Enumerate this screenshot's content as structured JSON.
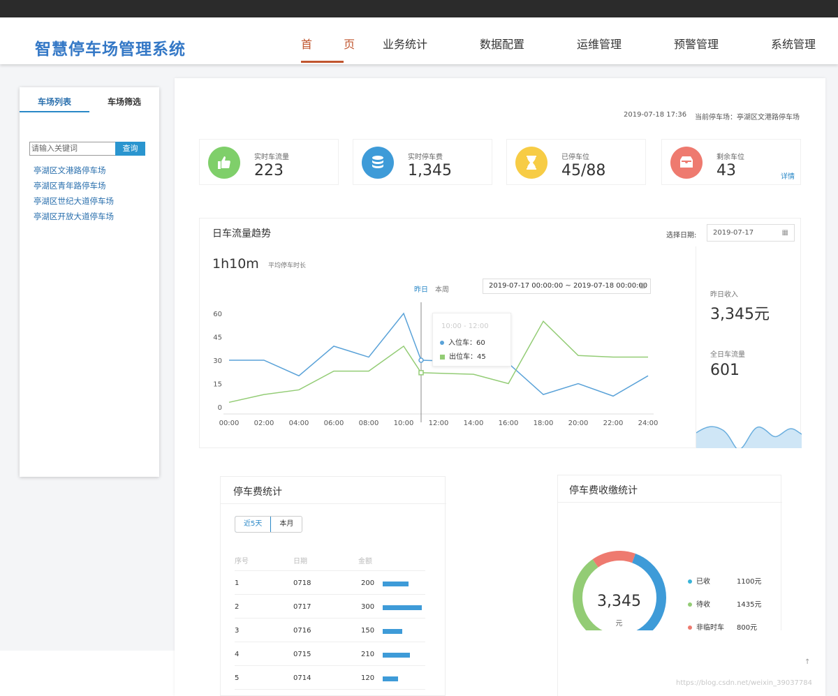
{
  "header": {
    "app_title": "智慧停车场管理系统",
    "nav": [
      "首 页",
      "业务统计",
      "数据配置",
      "运维管理",
      "预警管理",
      "系统管理"
    ]
  },
  "sidebar": {
    "tabs": [
      "车场列表",
      "车场筛选"
    ],
    "search_placeholder": "请输入关键词",
    "search_button": "查询",
    "lots": [
      "亭湖区文港路停车场",
      "亭湖区青年路停车场",
      "亭湖区世纪大道停车场",
      "亭湖区开放大道停车场"
    ]
  },
  "status": {
    "datetime": "2019-07-18 17:36",
    "current_lot": "当前停车场：亭湖区文港路停车场"
  },
  "cards": [
    {
      "label": "实时车流量",
      "value": "223",
      "icon": "thumbs-up-icon",
      "color": "#7fcf6a"
    },
    {
      "label": "实时停车费",
      "value": "1,345",
      "icon": "coin-stack-icon",
      "color": "#3e9bd8"
    },
    {
      "label": "已停车位",
      "value": "45/88",
      "icon": "hourglass-icon",
      "color": "#f7cc45"
    },
    {
      "label": "剩余车位",
      "value": "43",
      "icon": "inbox-tray-icon",
      "color": "#ee7a6f",
      "link": "详情"
    }
  ],
  "trend": {
    "title": "日车流量趋势",
    "date_label": "选择日期:",
    "date_value": "2019-07-17",
    "avg_value": "1h10m",
    "avg_label": "平均停车时长",
    "range_tabs": [
      "昨日",
      "本周"
    ],
    "range_value": "2019-07-17 00:00:00 ~ 2019-07-18 00:00:00",
    "tooltip": {
      "title": "10:00 - 12:00",
      "in_label": "入位车：60",
      "out_label": "出位车：45"
    },
    "right": {
      "income_label": "昨日收入",
      "income_value": "3,345元",
      "flow_label": "全日车流量",
      "flow_value": "601"
    }
  },
  "chart_data": {
    "type": "line",
    "x": [
      "00:00",
      "02:00",
      "04:00",
      "06:00",
      "08:00",
      "10:00",
      "11:00",
      "12:00",
      "14:00",
      "16:00",
      "18:00",
      "20:00",
      "22:00",
      "24:00"
    ],
    "x_ticks": [
      "00:00",
      "02:00",
      "04:00",
      "06:00",
      "08:00",
      "10:00",
      "12:00",
      "14:00",
      "16:00",
      "18:00",
      "20:00",
      "22:00",
      "24:00"
    ],
    "y_ticks": [
      "0",
      "15",
      "30",
      "45",
      "60"
    ],
    "ylim": [
      0,
      60
    ],
    "series": [
      {
        "name": "入位车",
        "color": "#5aa2d8",
        "values": [
          30,
          30,
          20,
          39,
          32,
          60,
          30,
          29,
          28,
          8,
          15,
          7,
          20
        ]
      },
      {
        "name": "出位车",
        "color": "#93cc75",
        "values": [
          3,
          8,
          11,
          23,
          23,
          39,
          22,
          21,
          15,
          55,
          33,
          32,
          32
        ]
      }
    ],
    "grid": false
  },
  "fees": {
    "title": "停车费统计",
    "tabs": [
      "近5天",
      "本月"
    ],
    "headers": [
      "序号",
      "日期",
      "金额"
    ],
    "rows": [
      {
        "no": "1",
        "date": "0718",
        "amount": "200",
        "value": 200
      },
      {
        "no": "2",
        "date": "0717",
        "amount": "300",
        "value": 300
      },
      {
        "no": "3",
        "date": "0716",
        "amount": "150",
        "value": 150
      },
      {
        "no": "4",
        "date": "0715",
        "amount": "210",
        "value": 210
      },
      {
        "no": "5",
        "date": "0714",
        "amount": "120",
        "value": 120
      }
    ]
  },
  "collection": {
    "title": "停车费收缴统计",
    "total": "3,345",
    "unit": "元",
    "legend": [
      {
        "label": "已收",
        "amount": "1100元",
        "value": 1100,
        "color": "#3e9bd8"
      },
      {
        "label": "待收",
        "amount": "1435元",
        "value": 1435,
        "color": "#93cc75"
      },
      {
        "label": "非临时车",
        "amount": "800元",
        "value": 800,
        "color": "#ee7a6f"
      }
    ]
  },
  "watermark": "https://blog.csdn.net/weixin_39037784"
}
